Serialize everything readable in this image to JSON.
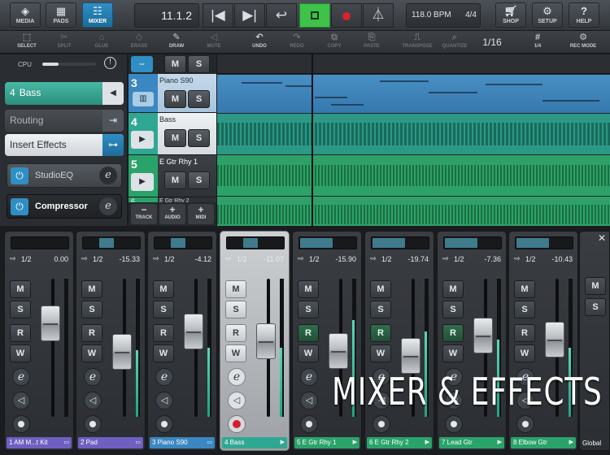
{
  "topbar": {
    "media": "MEDIA",
    "pads": "PADS",
    "mixer": "MIXER",
    "position": "11.1.2",
    "tempo": "118.0 BPM",
    "signature": "4/4",
    "shop": "SHOP",
    "setup": "SETUP",
    "help": "HELP"
  },
  "toolbar": {
    "select": "SELECT",
    "split": "SPLIT",
    "glue": "GLUE",
    "erase": "ERASE",
    "draw": "DRAW",
    "mute": "MUTE",
    "undo": "UNDO",
    "redo": "REDO",
    "copy": "COPY",
    "paste": "PASTE",
    "transpose": "TRANSPOSE",
    "quantize": "QUANTIZE",
    "quantize_value": "1/16",
    "grid_value": "1/4",
    "rec_mode": "REC MODE"
  },
  "left": {
    "cpu": "CPU",
    "cpu_level": 0.3,
    "track_num": "4",
    "track_name": "Bass",
    "routing": "Routing",
    "insert_effects": "Insert Effects",
    "fx1": "StudioEQ",
    "fx2": "Compressor"
  },
  "header_btns": {
    "m": "M",
    "s": "S",
    "e": "e",
    "r": "R",
    "w": "W"
  },
  "tracks": [
    {
      "num": "3",
      "name": "Piano S90",
      "color": "#3a87c2"
    },
    {
      "num": "4",
      "name": "Bass",
      "color": "#2fa893"
    },
    {
      "num": "5",
      "name": "E Gtr Rhy 1",
      "color": "#2aa36a"
    },
    {
      "num": "6",
      "name": "E Gtr Rhy 2",
      "color": "#2aa36a"
    }
  ],
  "track_actions": {
    "track": "TRACK",
    "audio": "AUDIO",
    "midi": "MIDI"
  },
  "channels": [
    {
      "io": "1/2",
      "vol": "0.00",
      "name": "1  AM M...t Kit",
      "fader": 0.74,
      "meter": 0,
      "color": "#6f5fc1",
      "rgreen": false
    },
    {
      "io": "1/2",
      "vol": "-15.33",
      "name": "2  Pad",
      "fader": 0.46,
      "meter": 0.48,
      "color": "#6f5fc1",
      "rgreen": false
    },
    {
      "io": "1/2",
      "vol": "-4.12",
      "name": "3  Piano S90",
      "fader": 0.66,
      "meter": 0.5,
      "color": "#3a87c2",
      "rgreen": false
    },
    {
      "io": "1/2",
      "vol": "-11.07",
      "name": "4  Bass",
      "fader": 0.56,
      "meter": 0.5,
      "color": "#2fa893",
      "rgreen": false
    },
    {
      "io": "1/2",
      "vol": "-15.90",
      "name": "5  E Gtr Rhy 1",
      "fader": 0.47,
      "meter": 0.7,
      "color": "#2aa36a",
      "rgreen": true
    },
    {
      "io": "1/2",
      "vol": "-19.74",
      "name": "6  E Gtr Rhy 2",
      "fader": 0.42,
      "meter": 0.62,
      "color": "#2aa36a",
      "rgreen": true
    },
    {
      "io": "1/2",
      "vol": "-7.36",
      "name": "7  Lead Gtr",
      "fader": 0.62,
      "meter": 0.56,
      "color": "#2aa36a",
      "rgreen": true
    },
    {
      "io": "1/2",
      "vol": "-10.43",
      "name": "8  Elbow Gtr",
      "fader": 0.58,
      "meter": 0.5,
      "color": "#2aa36a",
      "rgreen": false
    }
  ],
  "global_label": "Global",
  "overlay_text": "MIXER & EFFECTS"
}
